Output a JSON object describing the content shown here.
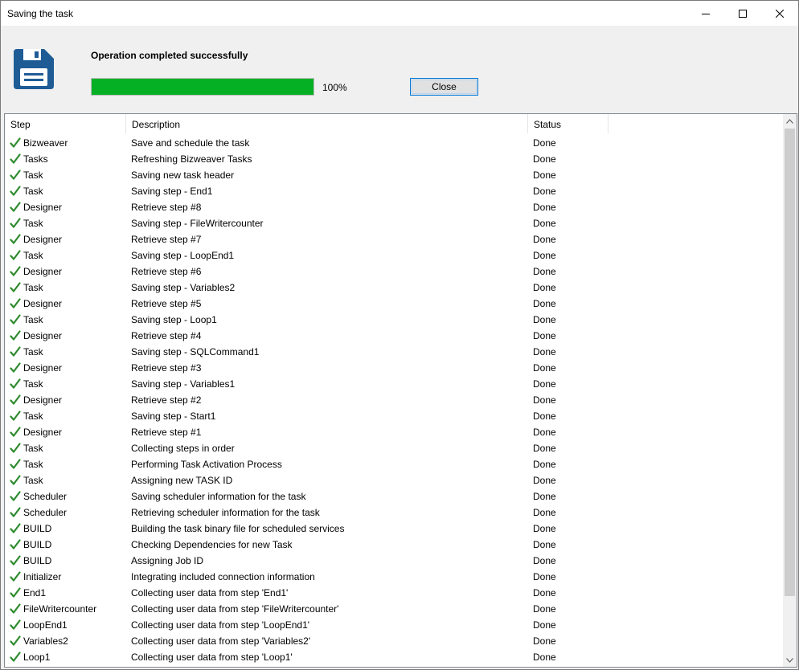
{
  "window": {
    "title": "Saving the task"
  },
  "header": {
    "message": "Operation completed successfully",
    "progress_value": 100,
    "progress_label": "100%",
    "close_label": "Close",
    "accent_color": "#06b025",
    "icon": "floppy-disk-icon"
  },
  "table": {
    "columns": [
      "Step",
      "Description",
      "Status"
    ],
    "rows": [
      {
        "step": "Bizweaver",
        "description": "Save and schedule the task",
        "status": "Done"
      },
      {
        "step": "Tasks",
        "description": "Refreshing Bizweaver Tasks",
        "status": "Done"
      },
      {
        "step": "Task",
        "description": "Saving new task header",
        "status": "Done"
      },
      {
        "step": "Task",
        "description": "Saving step - End1",
        "status": "Done"
      },
      {
        "step": "Designer",
        "description": "Retrieve step #8",
        "status": "Done"
      },
      {
        "step": "Task",
        "description": "Saving step - FileWritercounter",
        "status": "Done"
      },
      {
        "step": "Designer",
        "description": "Retrieve step #7",
        "status": "Done"
      },
      {
        "step": "Task",
        "description": "Saving step - LoopEnd1",
        "status": "Done"
      },
      {
        "step": "Designer",
        "description": "Retrieve step #6",
        "status": "Done"
      },
      {
        "step": "Task",
        "description": "Saving step - Variables2",
        "status": "Done"
      },
      {
        "step": "Designer",
        "description": "Retrieve step #5",
        "status": "Done"
      },
      {
        "step": "Task",
        "description": "Saving step - Loop1",
        "status": "Done"
      },
      {
        "step": "Designer",
        "description": "Retrieve step #4",
        "status": "Done"
      },
      {
        "step": "Task",
        "description": "Saving step - SQLCommand1",
        "status": "Done"
      },
      {
        "step": "Designer",
        "description": "Retrieve step #3",
        "status": "Done"
      },
      {
        "step": "Task",
        "description": "Saving step - Variables1",
        "status": "Done"
      },
      {
        "step": "Designer",
        "description": "Retrieve step #2",
        "status": "Done"
      },
      {
        "step": "Task",
        "description": "Saving step - Start1",
        "status": "Done"
      },
      {
        "step": "Designer",
        "description": "Retrieve step #1",
        "status": "Done"
      },
      {
        "step": "Task",
        "description": "Collecting steps in order",
        "status": "Done"
      },
      {
        "step": "Task",
        "description": "Performing Task Activation Process",
        "status": "Done"
      },
      {
        "step": "Task",
        "description": "Assigning new TASK ID",
        "status": "Done"
      },
      {
        "step": "Scheduler",
        "description": "Saving scheduler information for the task",
        "status": "Done"
      },
      {
        "step": "Scheduler",
        "description": "Retrieving scheduler information for the task",
        "status": "Done"
      },
      {
        "step": "BUILD",
        "description": "Building the task binary file for scheduled services",
        "status": "Done"
      },
      {
        "step": "BUILD",
        "description": "Checking Dependencies for new Task",
        "status": "Done"
      },
      {
        "step": "BUILD",
        "description": "Assigning Job ID",
        "status": "Done"
      },
      {
        "step": "Initializer",
        "description": "Integrating included connection information",
        "status": "Done"
      },
      {
        "step": "End1",
        "description": "Collecting user data from step 'End1'",
        "status": "Done"
      },
      {
        "step": "FileWritercounter",
        "description": "Collecting user data from step 'FileWritercounter'",
        "status": "Done"
      },
      {
        "step": "LoopEnd1",
        "description": "Collecting user data from step 'LoopEnd1'",
        "status": "Done"
      },
      {
        "step": "Variables2",
        "description": "Collecting user data from step 'Variables2'",
        "status": "Done"
      },
      {
        "step": "Loop1",
        "description": "Collecting user data from step 'Loop1'",
        "status": "Done"
      }
    ],
    "row_icon": "checkmark-icon",
    "check_color": "#2e8b2e"
  }
}
